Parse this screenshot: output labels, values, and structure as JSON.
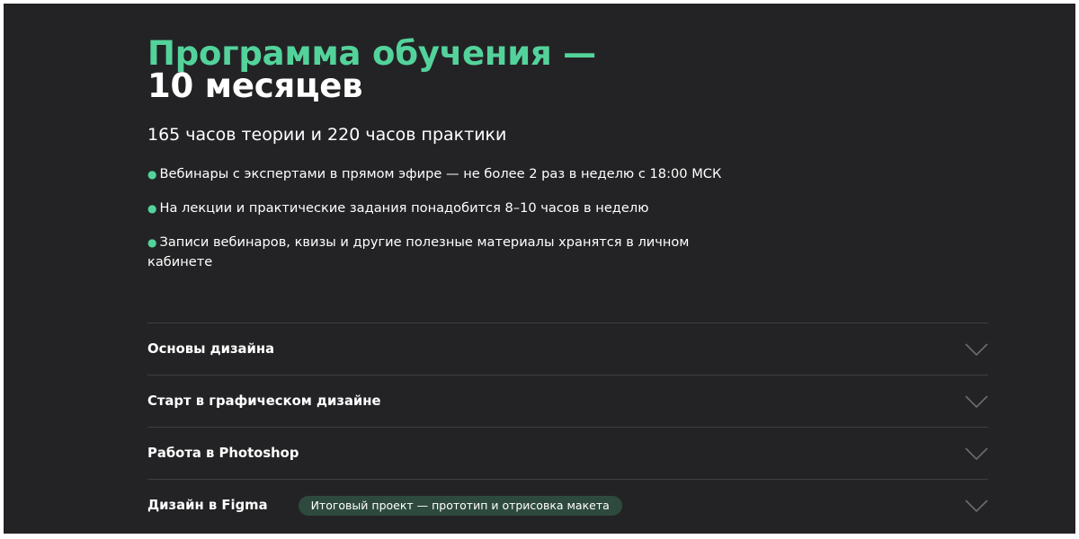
{
  "program": {
    "title_accent": "Программа обучения —",
    "title_main": "10 месяцев",
    "subtitle": "165 часов теории и 220 часов практики",
    "bullet_marker": "●",
    "bullets": [
      "Вебинары с экспертами в прямом эфире — не более 2 раз в неделю с 18:00 МСК",
      "На лекции и практические задания понадобится 8–10 часов в неделю",
      "Записи вебинаров, квизы и другие полезные материалы хранятся в личном кабинете"
    ]
  },
  "modules": [
    {
      "title": "Основы дизайна"
    },
    {
      "title": "Старт в графическом дизайне"
    },
    {
      "title": "Работа в Photoshop"
    },
    {
      "title": "Дизайн в Figma",
      "badge": "Итоговый проект — прототип и отрисовка макета"
    }
  ],
  "icons": {
    "chevron": "chevron-down-icon"
  },
  "colors": {
    "background": "#232325",
    "accent": "#53d39b",
    "text": "#ffffff",
    "divider": "#3e3f42",
    "badge_bg": "#2e4a3e"
  }
}
